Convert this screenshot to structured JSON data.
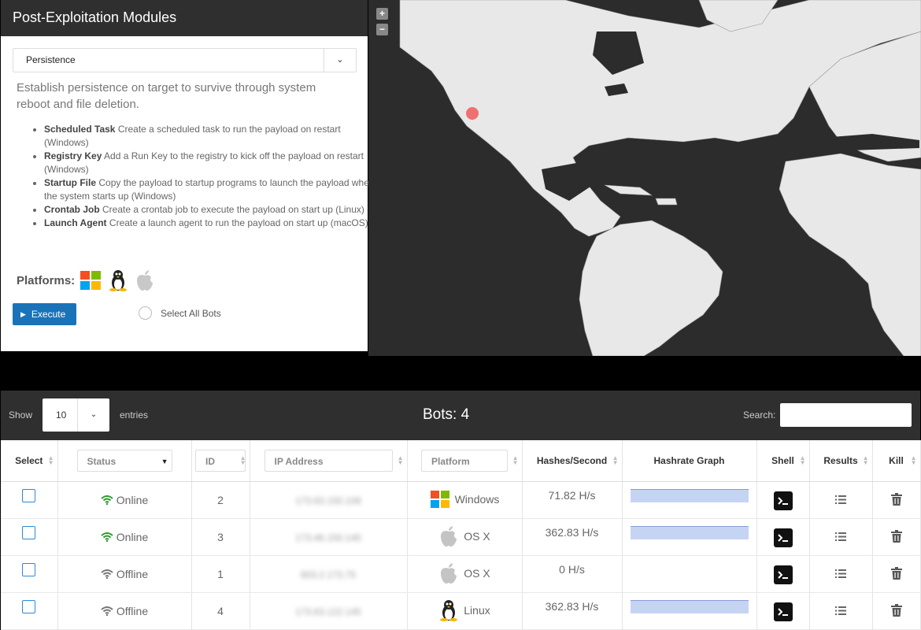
{
  "module_panel": {
    "title": "Post-Exploitation Modules",
    "selected_module": "Persistence",
    "description": "Establish persistence on target to survive through system reboot and file deletion.",
    "options": [
      {
        "name": "Scheduled Task",
        "text": "Create a scheduled task to run the payload on restart (Windows)"
      },
      {
        "name": "Registry Key",
        "text": "Add a Run Key to the registry to kick off the payload on restart (Windows)"
      },
      {
        "name": "Startup File",
        "text": "Copy the payload to startup programs to launch the payload when the system starts up (Windows)"
      },
      {
        "name": "Crontab Job",
        "text": "Create a crontab job to execute the payload on start up (Linux)"
      },
      {
        "name": "Launch Agent",
        "text": "Create a launch agent to run the payload on start up (macOS)"
      }
    ],
    "platforms_label": "Platforms:",
    "platform_icons": [
      "windows-icon",
      "linux-icon",
      "apple-icon"
    ],
    "execute_label": "Execute",
    "select_all_label": "Select All Bots"
  },
  "map": {
    "zoom_in": "+",
    "zoom_out": "−",
    "marker_color": "#f05a5a",
    "land_color": "#e8e8e8",
    "water_color": "#2c2c2c"
  },
  "table": {
    "show_label": "Show",
    "entries_value": "10",
    "entries_label": "entries",
    "bots_label": "Bots: 4",
    "search_label": "Search:",
    "headers": {
      "select": "Select",
      "status": "Status",
      "id": "ID",
      "ip": "IP Address",
      "platform": "Platform",
      "hashes": "Hashes/Second",
      "graph": "Hashrate Graph",
      "shell": "Shell",
      "results": "Results",
      "kill": "Kill"
    },
    "rows": [
      {
        "status": "Online",
        "id": "2",
        "ip": "173.63.150.108",
        "platform": "Windows",
        "hashrate": "71.82 H/s",
        "graph": true
      },
      {
        "status": "Online",
        "id": "3",
        "ip": "173.46.150.145",
        "platform": "OS X",
        "hashrate": "362.83 H/s",
        "graph": true
      },
      {
        "status": "Offline",
        "id": "1",
        "ip": "603.2.173.75",
        "platform": "OS X",
        "hashrate": "0 H/s",
        "graph": false
      },
      {
        "status": "Offline",
        "id": "4",
        "ip": "173.63.122.145",
        "platform": "Linux",
        "hashrate": "362.83 H/s",
        "graph": true
      }
    ],
    "colors": {
      "online": "#2e9b2e",
      "offline": "#777777",
      "checkbox": "#2a8bd8",
      "accent": "#1a73b8"
    }
  }
}
